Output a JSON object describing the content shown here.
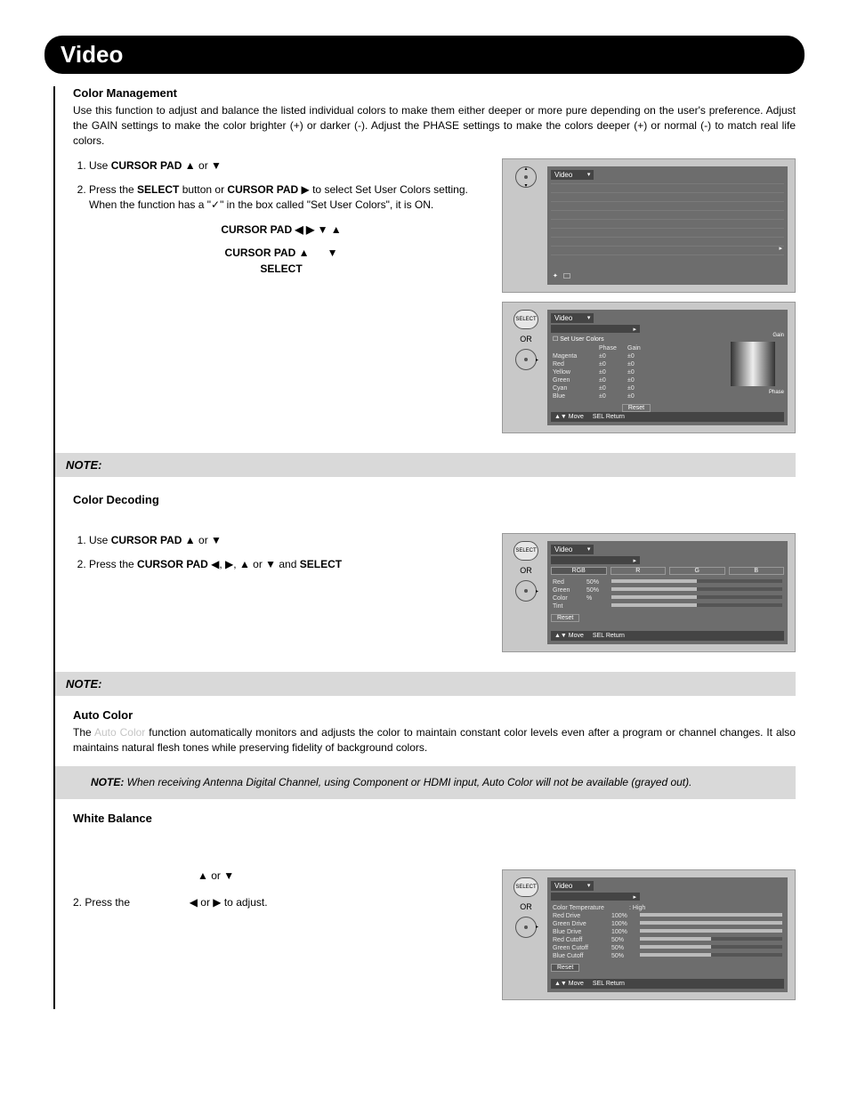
{
  "header": {
    "title": "Video"
  },
  "color_management": {
    "heading": "Color Management",
    "intro": "Use this function to adjust and balance the listed individual colors to make them either deeper or more pure depending on the user's preference.  Adjust the GAIN settings to make the color brighter (+) or darker (-).  Adjust the PHASE settings to make the colors deeper (+) or normal (-) to match real life colors.",
    "step1_pre": "Use ",
    "cursor_pad_label": "CURSOR PAD",
    "step1_post": " ▲ or ▼",
    "step2a": "Press the ",
    "select_label": "SELECT",
    "step2b": " button or ",
    "step2c": " ▶ to select Set User Colors setting.  When the function has a \"✓\" in the box called \"Set User Colors\", it is ON.",
    "cursor_line1": "CURSOR PAD  ◀  ▶  ▼  ▲",
    "cursor_line2a": "CURSOR PAD  ▲",
    "cursor_line2b": "▼",
    "cursor_line3": "SELECT"
  },
  "note1": "NOTE:",
  "osd_video_label": "Video",
  "osd_select": "SELECT",
  "osd_or": "OR",
  "osd_cm": {
    "subhead": "☐  Set User Colors",
    "cols": {
      "phase": "Phase",
      "gain": "Gain"
    },
    "right_labels": {
      "gain": "Gain",
      "phase": "Phase"
    },
    "rows": [
      {
        "name": "Magenta",
        "phase": "±0",
        "gain": "±0"
      },
      {
        "name": "Red",
        "phase": "±0",
        "gain": "±0"
      },
      {
        "name": "Yellow",
        "phase": "±0",
        "gain": "±0"
      },
      {
        "name": "Green",
        "phase": "±0",
        "gain": "±0"
      },
      {
        "name": "Cyan",
        "phase": "±0",
        "gain": "±0"
      },
      {
        "name": "Blue",
        "phase": "±0",
        "gain": "±0"
      }
    ],
    "reset": "Reset",
    "footer_move": "▲▼ Move",
    "footer_return": "SEL Return"
  },
  "color_decoding": {
    "heading": "Color Decoding",
    "step1_pre": "Use ",
    "step1_post": " ▲ or ▼",
    "step2a": "Press the ",
    "step2b": " ◀, ▶, ▲ or ▼ and ",
    "tabs": [
      "RGB",
      "R",
      "G",
      "B"
    ],
    "rows": [
      {
        "name": "Red",
        "val": "50%"
      },
      {
        "name": "Green",
        "val": "50%"
      },
      {
        "name": "Color",
        "val": "%"
      },
      {
        "name": "Tint",
        "val": ""
      }
    ],
    "reset": "Reset"
  },
  "note2": "NOTE:",
  "auto_color": {
    "heading": "Auto Color",
    "body_pre": "The ",
    "body_post": " function automatically monitors and adjusts the color to maintain constant color levels even after a program or channel changes. It also maintains natural flesh tones while preserving fidelity of background colors."
  },
  "note3_label": "NOTE:",
  "note3_body": " When receiving Antenna Digital Channel, using Component or HDMI input, Auto Color will not be available (grayed out).",
  "white_balance": {
    "heading": "White Balance",
    "step1_mid": "▲ or ▼",
    "step2a": "2.    Press the",
    "step2b": "◀ or ▶  to adjust.",
    "ct_label": "Color Temperature",
    "ct_val": ": High",
    "rows": [
      {
        "name": "Red Drive",
        "val": "100%",
        "fill": 100
      },
      {
        "name": "Green Drive",
        "val": "100%",
        "fill": 100
      },
      {
        "name": "Blue Drive",
        "val": "100%",
        "fill": 100
      },
      {
        "name": "Red Cutoff",
        "val": "50%",
        "fill": 50
      },
      {
        "name": "Green Cutoff",
        "val": "50%",
        "fill": 50
      },
      {
        "name": "Blue Cutoff",
        "val": "50%",
        "fill": 50
      }
    ],
    "reset": "Reset"
  },
  "footer_move": "▲▼ Move",
  "footer_return": "SEL Return"
}
